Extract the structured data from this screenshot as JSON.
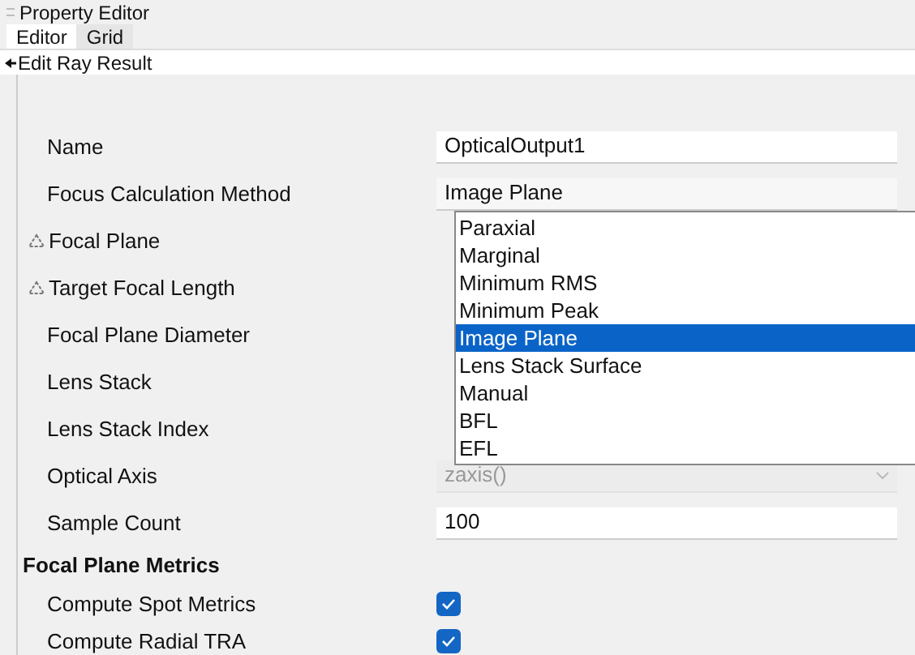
{
  "panel": {
    "title": "Property Editor"
  },
  "tabs": [
    {
      "label": "Editor",
      "selected": true
    },
    {
      "label": "Grid",
      "selected": false
    }
  ],
  "back_link": "Edit Ray Result",
  "rows": [
    {
      "kind": "field",
      "label": "Name",
      "value": "OpticalOutput1"
    },
    {
      "kind": "dropdown",
      "label": "Focus Calculation Method",
      "value": "Image Plane",
      "disabled": false,
      "expanded": true,
      "options": [
        {
          "label": "Paraxial",
          "selected": false
        },
        {
          "label": "Marginal",
          "selected": false
        },
        {
          "label": "Minimum RMS",
          "selected": false
        },
        {
          "label": "Minimum Peak",
          "selected": false
        },
        {
          "label": "Image Plane",
          "selected": true
        },
        {
          "label": "Lens Stack Surface",
          "selected": false
        },
        {
          "label": "Manual",
          "selected": false
        },
        {
          "label": "BFL",
          "selected": false
        },
        {
          "label": "EFL",
          "selected": false
        }
      ]
    },
    {
      "kind": "label",
      "label": "Focal Plane",
      "marked": true
    },
    {
      "kind": "label",
      "label": "Target Focal Length",
      "marked": true
    },
    {
      "kind": "label",
      "label": "Focal Plane Diameter",
      "marked": false
    },
    {
      "kind": "label",
      "label": "Lens Stack",
      "marked": false
    },
    {
      "kind": "label",
      "label": "Lens Stack Index",
      "marked": false
    },
    {
      "kind": "dropdown",
      "label": "Optical Axis",
      "value": "zaxis()",
      "disabled": true,
      "expanded": false
    },
    {
      "kind": "field",
      "label": "Sample Count",
      "value": "100"
    },
    {
      "kind": "section",
      "label": "Focal Plane Metrics"
    },
    {
      "kind": "checkbox",
      "label": "Compute Spot Metrics",
      "checked": true
    },
    {
      "kind": "checkbox",
      "label": "Compute Radial TRA",
      "checked": true
    }
  ]
}
